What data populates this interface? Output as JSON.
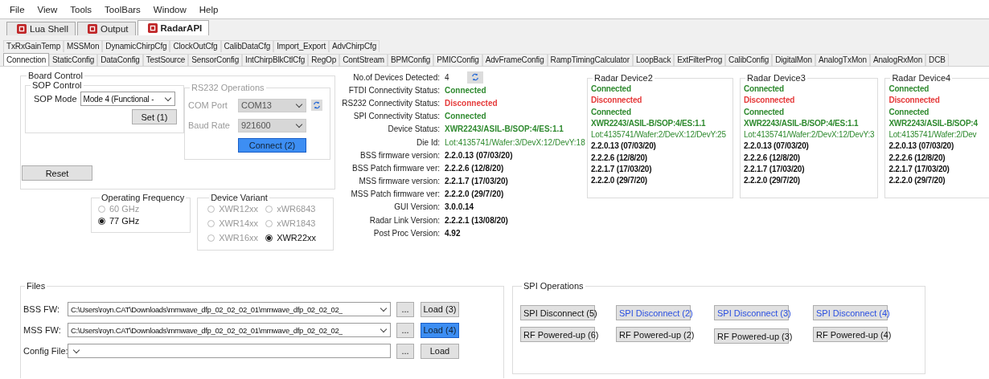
{
  "menu": [
    "File",
    "View",
    "Tools",
    "ToolBars",
    "Window",
    "Help"
  ],
  "doc_tabs": [
    {
      "label": "Lua Shell",
      "selected": false
    },
    {
      "label": "Output",
      "selected": false
    },
    {
      "label": "RadarAPI",
      "selected": true
    }
  ],
  "tabs_row1": [
    {
      "label": "TxRxGainTemp",
      "selected": false
    },
    {
      "label": "MSSMon",
      "selected": false
    },
    {
      "label": "DynamicChirpCfg",
      "selected": false
    },
    {
      "label": "ClockOutCfg",
      "selected": false
    },
    {
      "label": "CalibDataCfg",
      "selected": false
    },
    {
      "label": "Import_Export",
      "selected": false
    },
    {
      "label": "AdvChirpCfg",
      "selected": false
    }
  ],
  "tabs_row2": [
    {
      "label": "Connection",
      "selected": true
    },
    {
      "label": "StaticConfig",
      "selected": false
    },
    {
      "label": "DataConfig",
      "selected": false
    },
    {
      "label": "TestSource",
      "selected": false
    },
    {
      "label": "SensorConfig",
      "selected": false
    },
    {
      "label": "IntChirpBlkCtlCfg",
      "selected": false
    },
    {
      "label": "RegOp",
      "selected": false
    },
    {
      "label": "ContStream",
      "selected": false
    },
    {
      "label": "BPMConfig",
      "selected": false
    },
    {
      "label": "PMICConfig",
      "selected": false
    },
    {
      "label": "AdvFrameConfig",
      "selected": false
    },
    {
      "label": "RampTimingCalculator",
      "selected": false
    },
    {
      "label": "LoopBack",
      "selected": false
    },
    {
      "label": "ExtFilterProg",
      "selected": false
    },
    {
      "label": "CalibConfig",
      "selected": false
    },
    {
      "label": "DigitalMon",
      "selected": false
    },
    {
      "label": "AnalogTxMon",
      "selected": false
    },
    {
      "label": "AnalogRxMon",
      "selected": false
    },
    {
      "label": "DCB",
      "selected": false
    }
  ],
  "board_control": {
    "title": "Board Control",
    "sop_control": {
      "title": "SOP Control",
      "label": "SOP Mode",
      "value": "Mode 4 (Functional -",
      "button": "Set (1)"
    },
    "rs232": {
      "title": "RS232 Operations",
      "disabled": true,
      "fields": [
        {
          "label": "COM Port",
          "value": "COM13"
        },
        {
          "label": "Baud Rate",
          "value": "921600"
        }
      ],
      "connect_button": {
        "label": "Connect (2)",
        "focused": true
      }
    },
    "reset_button": "Reset"
  },
  "operating_frequency": {
    "title": "Operating Frequency",
    "options": [
      {
        "label": "60 GHz",
        "selected": false
      },
      {
        "label": "77 GHz",
        "selected": true
      }
    ]
  },
  "device_variant": {
    "title": "Device Variant",
    "options": [
      {
        "label": "XWR12xx",
        "selected": false
      },
      {
        "label": "xWR6843",
        "selected": false
      },
      {
        "label": "XWR14xx",
        "selected": false
      },
      {
        "label": "xWR1843",
        "selected": false
      },
      {
        "label": "XWR16xx",
        "selected": false
      },
      {
        "label": "XWR22xx",
        "selected": true
      }
    ]
  },
  "device_info": [
    {
      "label": "No.of Devices Detected:",
      "value": "4",
      "kind": "count"
    },
    {
      "label": "FTDI Connectivity Status:",
      "value": "Connected",
      "kind": "good"
    },
    {
      "label": "RS232 Connectivity Status:",
      "value": "Disconnected",
      "kind": "bad"
    },
    {
      "label": "SPI Connectivity Status:",
      "value": "Connected",
      "kind": "good"
    },
    {
      "label": "Device Status:",
      "value": "XWR2243/ASIL-B/SOP:4/ES:1.1",
      "kind": "good"
    },
    {
      "label": "Die Id:",
      "value": "Lot:4135741/Wafer:3/DevX:12/DevY:18",
      "kind": "id"
    },
    {
      "label": "BSS firmware version:",
      "value": "2.2.0.13 (07/03/20)",
      "kind": "version"
    },
    {
      "label": "BSS Patch firmware ver:",
      "value": "2.2.2.6 (12/8/20)",
      "kind": "version"
    },
    {
      "label": "MSS firmware version:",
      "value": "2.2.1.7 (17/03/20)",
      "kind": "version"
    },
    {
      "label": "MSS Patch firmware ver:",
      "value": "2.2.2.0 (29/7/20)",
      "kind": "version"
    },
    {
      "label": "GUI Version:",
      "value": "3.0.0.14",
      "kind": "version"
    },
    {
      "label": "Radar Link Version:",
      "value": "2.2.2.1 (13/08/20)",
      "kind": "version"
    },
    {
      "label": "Post Proc Version:",
      "value": "4.92",
      "kind": "version"
    }
  ],
  "radar_devices": [
    {
      "title": "Radar Device2",
      "values": [
        {
          "text": "Connected",
          "kind": "good"
        },
        {
          "text": "Disconnected",
          "kind": "bad"
        },
        {
          "text": "Connected",
          "kind": "good"
        },
        {
          "text": "XWR2243/ASIL-B/SOP:4/ES:1.1",
          "kind": "good"
        },
        {
          "text": "Lot:4135741/Wafer:2/DevX:12/DevY:25",
          "kind": "id"
        },
        {
          "text": "2.2.0.13 (07/03/20)",
          "kind": "version"
        },
        {
          "text": "2.2.2.6 (12/8/20)",
          "kind": "version"
        },
        {
          "text": "2.2.1.7 (17/03/20)",
          "kind": "version"
        },
        {
          "text": "2.2.2.0 (29/7/20)",
          "kind": "version"
        }
      ]
    },
    {
      "title": "Radar Device3",
      "values": [
        {
          "text": "Connected",
          "kind": "good"
        },
        {
          "text": "Disconnected",
          "kind": "bad"
        },
        {
          "text": "Connected",
          "kind": "good"
        },
        {
          "text": "XWR2243/ASIL-B/SOP:4/ES:1.1",
          "kind": "good"
        },
        {
          "text": "Lot:4135741/Wafer:2/DevX:12/DevY:3",
          "kind": "id"
        },
        {
          "text": "2.2.0.13 (07/03/20)",
          "kind": "version"
        },
        {
          "text": "2.2.2.6 (12/8/20)",
          "kind": "version"
        },
        {
          "text": "2.2.1.7 (17/03/20)",
          "kind": "version"
        },
        {
          "text": "2.2.2.0 (29/7/20)",
          "kind": "version"
        }
      ]
    },
    {
      "title": "Radar Device4",
      "values": [
        {
          "text": "Connected",
          "kind": "good"
        },
        {
          "text": "Disconnected",
          "kind": "bad"
        },
        {
          "text": "Connected",
          "kind": "good"
        },
        {
          "text": "XWR2243/ASIL-B/SOP:4",
          "kind": "good"
        },
        {
          "text": "Lot:4135741/Wafer:2/Dev",
          "kind": "id"
        },
        {
          "text": "2.2.0.13 (07/03/20)",
          "kind": "version"
        },
        {
          "text": "2.2.2.6 (12/8/20)",
          "kind": "version"
        },
        {
          "text": "2.2.1.7 (17/03/20)",
          "kind": "version"
        },
        {
          "text": "2.2.2.0 (29/7/20)",
          "kind": "version"
        }
      ]
    }
  ],
  "files": {
    "title": "Files",
    "rows": [
      {
        "label": "BSS FW:",
        "value": "C:\\Users\\royn.CAT\\Downloads\\mmwave_dfp_02_02_02_01\\mmwave_dfp_02_02_02_",
        "browse": "...",
        "load": {
          "label": "Load (3)",
          "focused": false
        }
      },
      {
        "label": "MSS FW:",
        "value": "C:\\Users\\royn.CAT\\Downloads\\mmwave_dfp_02_02_02_01\\mmwave_dfp_02_02_02_",
        "browse": "...",
        "load": {
          "label": "Load (4)",
          "focused": true
        }
      },
      {
        "label": "Config File:",
        "value": "",
        "browse": "...",
        "load": {
          "label": "Load",
          "focused": false
        }
      }
    ]
  },
  "spi_operations": {
    "title": "SPI Operations",
    "columns": [
      {
        "disconnect": {
          "label": "SPI Disconnect (5)",
          "highlighted": false
        },
        "power": "RF Powered-up (6)"
      },
      {
        "disconnect": {
          "label": "SPI Disconnect (2)",
          "highlighted": true
        },
        "power": "RF Powered-up (2)"
      },
      {
        "disconnect": {
          "label": "SPI Disconnect (3)",
          "highlighted": true
        },
        "power": "RF Powered-up (3)"
      },
      {
        "disconnect": {
          "label": "SPI Disconnect (4)",
          "highlighted": true
        },
        "power": "RF Powered-up (4)"
      }
    ]
  }
}
